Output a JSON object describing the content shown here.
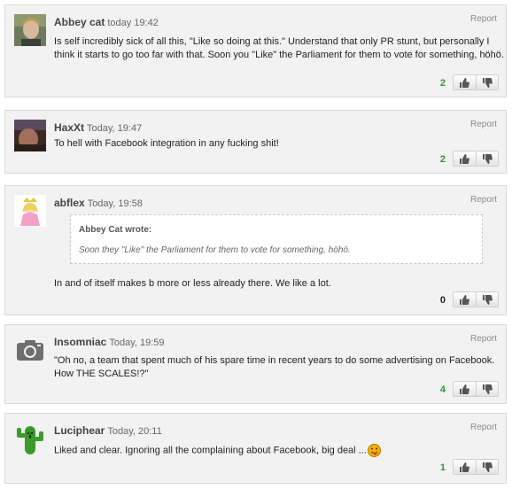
{
  "comments": [
    {
      "author": "Abbey cat",
      "time": "today 19:42",
      "report_label": "Report",
      "lines": [
        "Is self incredibly sick of all this, \"Like so doing at this.\" Understand that only PR stunt, but personally I",
        "think it starts to go too far with that. Soon you \"Like\" the Parliament for them to vote for something, höhö."
      ],
      "score": "2"
    },
    {
      "author": "HaxXt",
      "time": "Today, 19:47",
      "report_label": "Report",
      "lines": [
        "To hell with Facebook integration in any fucking shit!"
      ],
      "score": "2"
    },
    {
      "author": "abflex",
      "time": "Today, 19:58",
      "report_label": "Report",
      "quote": {
        "author": "Abbey Cat wrote:",
        "text": "Soon they \"Like\" the Parliament for them to vote for something, höhö."
      },
      "lines": [
        "In and of itself makes b more or less already there. We like a lot."
      ],
      "score": "0"
    },
    {
      "author": "Insomniac",
      "time": "Today, 19:59",
      "report_label": "Report",
      "lines": [
        "\"Oh no, a team that spent much of his spare time in recent years to do some advertising on Facebook.",
        "How THE SCALES!?\""
      ],
      "score": "4"
    },
    {
      "author": "Luciphear",
      "time": "Today, 20:11",
      "report_label": "Report",
      "lines": [
        "Liked and clear. Ignoring all the complaining about Facebook, big deal ..."
      ],
      "score": "1"
    }
  ],
  "colors": {
    "positive_score": "#2a9b2a",
    "zero_score": "#222222",
    "card_bg": "#f2f2f2",
    "border": "#d9d9d9"
  },
  "icons": {
    "upvote": "thumbs-up-icon",
    "downvote": "thumbs-down-icon",
    "emoticon": "tongue-smiley-icon"
  }
}
